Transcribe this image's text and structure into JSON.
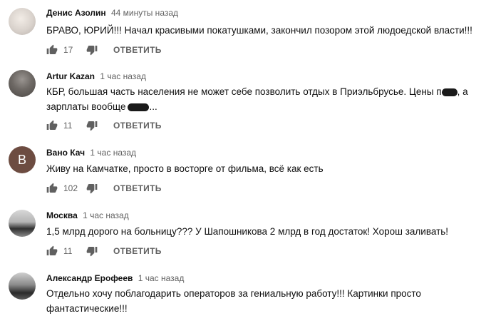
{
  "comments": [
    {
      "author": "Денис Азолин",
      "time": "44 минуты назад",
      "text": "БРАВО, ЮРИЙ!!! Начал красивыми покатушками, закончил позором этой людоедской власти!!!",
      "likes": "17",
      "reply_label": "ОТВЕТИТЬ",
      "avatar_letter": ""
    },
    {
      "author": "Artur Kazan",
      "time": "1 час назад",
      "text_line1": "КБР, большая часть населения не может себе позволить отдых в Приэльбрусье. Цены п",
      "text_line1_end": ", а",
      "text_line2": "зарплаты вообще",
      "text_line2_end": "...",
      "likes": "11",
      "reply_label": "ОТВЕТИТЬ"
    },
    {
      "author": "Вано Кач",
      "time": "1 час назад",
      "text": "Живу на Камчатке, просто в восторге от фильма, всё как есть",
      "likes": "102",
      "reply_label": "ОТВЕТИТЬ",
      "avatar_letter": "B"
    },
    {
      "author": "Москва",
      "time": "1 час назад",
      "text": "1,5 млрд дорого на больницу??? У Шапошникова 2 млрд в год достаток! Хорош заливать!",
      "likes": "11",
      "reply_label": "ОТВЕТИТЬ"
    },
    {
      "author": "Александр Ерофеев",
      "time": "1 час назад",
      "text_line1": "Отдельно хочу поблагодарить операторов за гениальную работу!!! Картинки просто",
      "text_line2": "фантастические!!!"
    }
  ],
  "icons": {
    "like": "thumb-up-icon",
    "dislike": "thumb-down-icon"
  },
  "colors": {
    "text": "#0f0f0f",
    "secondary": "#606060",
    "avatar_letter_bg": "#6d4c41"
  }
}
